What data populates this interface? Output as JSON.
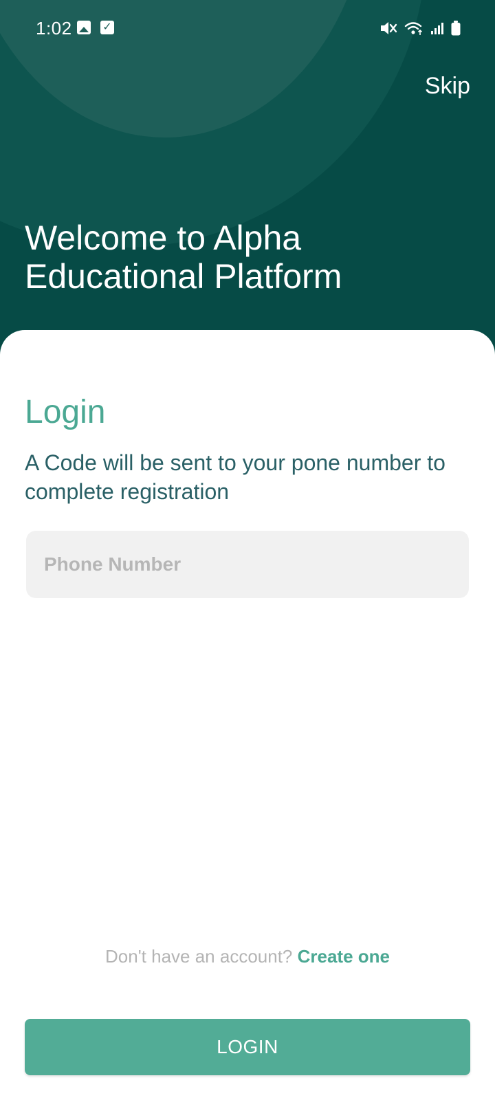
{
  "status_bar": {
    "time": "1:02",
    "icons": [
      "gallery-icon",
      "check-icon",
      "mute-icon",
      "wifi-icon",
      "signal-icon",
      "battery-icon"
    ]
  },
  "header": {
    "skip_label": "Skip",
    "welcome_text": "Welcome to Alpha Educational Platform",
    "background_color": "#064b46"
  },
  "login": {
    "title": "Login",
    "subtitle": "A Code will be sent to your pone number to complete registration",
    "phone_placeholder": "Phone Number",
    "phone_value": "",
    "signup_prompt": "Don't have an account?",
    "signup_link": "Create one",
    "button_label": "LOGIN"
  },
  "colors": {
    "accent": "#52ac96",
    "title": "#4ba893",
    "subtitle": "#2a6066"
  }
}
